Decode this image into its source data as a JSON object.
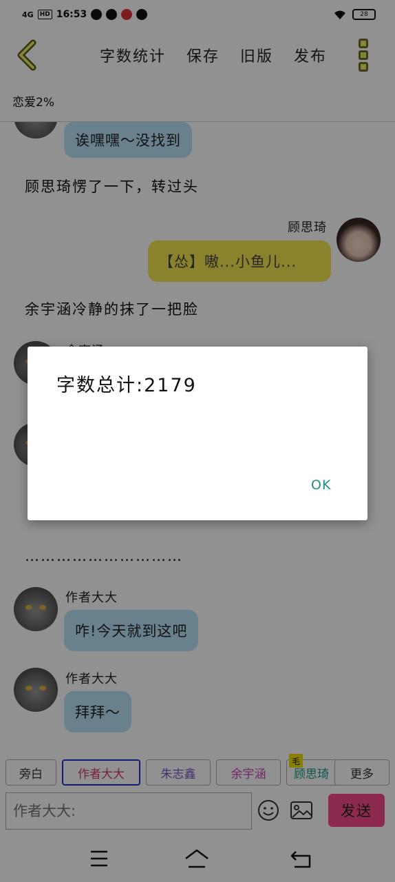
{
  "status_bar": {
    "network": "4G",
    "hd": "HD",
    "time": "16:53",
    "battery": "28"
  },
  "toolbar": {
    "items": [
      "字数统计",
      "保存",
      "旧版",
      "发布"
    ]
  },
  "subtitle": "恋爱2%",
  "chat": {
    "partial_bubble": "诶嘿嘿～没找到",
    "narration1": "顾思琦愣了一下，转过头",
    "msg_right_name": "顾思琦",
    "msg_right_text": "【怂】嗷...小鱼儿...",
    "narration2": "余宇涵冷静的抹了一把脸",
    "partial_name": "余宇涵",
    "narration3": "…………………………",
    "msg1_name": "作者大大",
    "msg1_text": "咋!今天就到这吧",
    "msg2_name": "作者大大",
    "msg2_text": "拜拜～"
  },
  "chips": {
    "items": [
      "旁白",
      "作者大大",
      "朱志鑫",
      "余宇涵",
      "顾思琦",
      "更多"
    ],
    "colors": [
      "#333333",
      "#d43a6a",
      "#7a55c8",
      "#c844b8",
      "#1a9a8a",
      "#333333"
    ],
    "badge": "毛"
  },
  "input": {
    "placeholder": "作者大大:"
  },
  "send_label": "发送",
  "dialog": {
    "message": "字数总计:2179",
    "ok_label": "OK"
  }
}
